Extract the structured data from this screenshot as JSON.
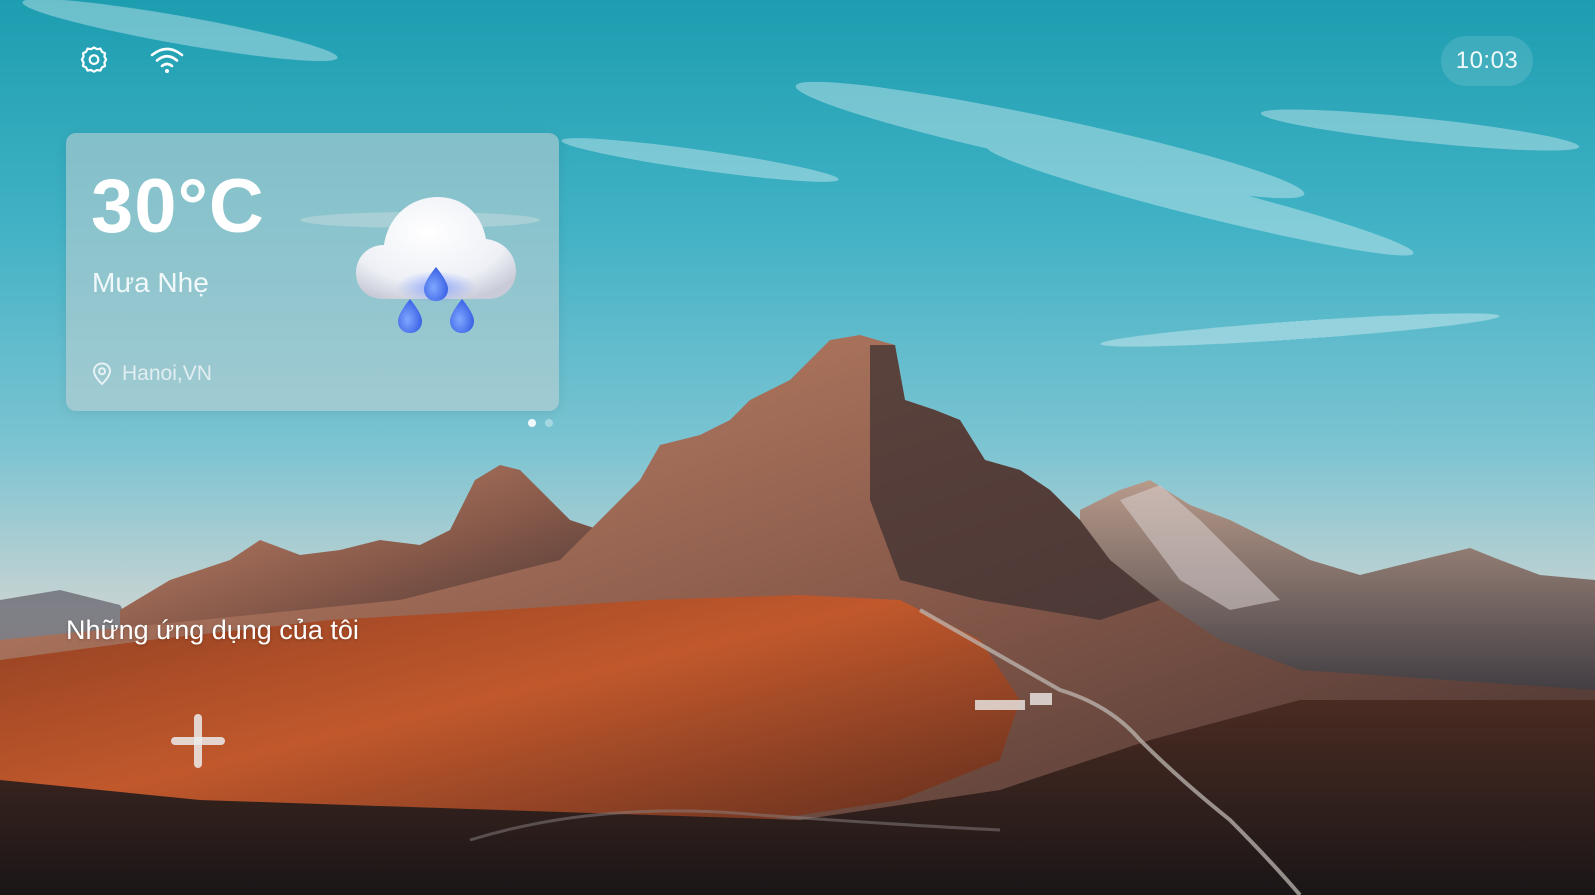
{
  "status_bar": {
    "settings_icon": "gear-icon",
    "wifi_icon": "wifi-icon",
    "clock": "10:03"
  },
  "weather": {
    "temperature": "30°C",
    "condition": "Mưa Nhẹ",
    "location": "Hanoi,VN",
    "location_icon": "location-pin-icon",
    "illustration": "rain-cloud-icon",
    "pager": {
      "count": 2,
      "active_index": 0
    }
  },
  "apps": {
    "title": "Những ứng dụng của tôi",
    "add_icon": "plus-icon"
  },
  "colors": {
    "sky_top": "#1e9eb0",
    "mountain_lit": "#b55a34",
    "text": "#ffffff"
  }
}
